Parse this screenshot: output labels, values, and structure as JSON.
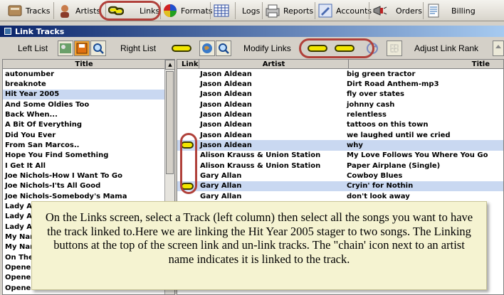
{
  "tabs": [
    {
      "label": "Tracks",
      "icon": "tracks-icon"
    },
    {
      "label": "Artists",
      "icon": "artists-icon"
    },
    {
      "label": "Links",
      "icon": "chain-link-icon"
    },
    {
      "label": "Formats",
      "icon": "color-wheel-icon"
    },
    {
      "label": "",
      "icon": "grid-icon"
    },
    {
      "label": "Logs",
      "icon": "logs-icon"
    },
    {
      "label": "Reports",
      "icon": "reports-icon"
    },
    {
      "label": "Accounts",
      "icon": "accounts-icon"
    },
    {
      "label": "Orders",
      "icon": "megaphone-icon"
    },
    {
      "label": "Billing",
      "icon": "billing-icon"
    }
  ],
  "window": {
    "title": "Link Tracks"
  },
  "toolbar": {
    "left_list": "Left List",
    "right_list": "Right List",
    "modify_links": "Modify Links",
    "adjust_rank": "Adjust Link Rank"
  },
  "left_pane": {
    "header": "Title",
    "rows": [
      "autonumber",
      "breaknote",
      "Hit Year 2005",
      "And Some Oldies Too",
      "Back When...",
      "A Bit Of Everything",
      "Did You Ever",
      "From San Marcos..",
      "Hope You Find Something",
      "I Get It All",
      "Joe Nichols-How I Want To Go",
      "Joe Nichols-I'ts All Good",
      "Joe Nichols-Somebody's Mama",
      "Lady A-",
      "Lady A-",
      "Lady A-",
      "My Nam",
      "My Nam",
      "On The",
      "Opener",
      "Opener",
      "Opener"
    ],
    "selected_index": 2
  },
  "right_pane": {
    "headers": {
      "link": "Link",
      "artist": "Artist",
      "title": "Title"
    },
    "rows": [
      {
        "artist": "Jason Aldean",
        "title": "big green tractor",
        "linked": false
      },
      {
        "artist": "Jason Aldean",
        "title": "Dirt Road Anthem-mp3",
        "linked": false
      },
      {
        "artist": "Jason Aldean",
        "title": "fly over states",
        "linked": false
      },
      {
        "artist": "Jason Aldean",
        "title": "johnny cash",
        "linked": false
      },
      {
        "artist": "Jason Aldean",
        "title": "relentless",
        "linked": false
      },
      {
        "artist": "Jason Aldean",
        "title": "tattoos on this town",
        "linked": false
      },
      {
        "artist": "Jason Aldean",
        "title": "we laughed until we cried",
        "linked": false
      },
      {
        "artist": "Jason Aldean",
        "title": "why",
        "linked": true
      },
      {
        "artist": "Alison Krauss & Union Station",
        "title": "My Love Follows You Where You Go",
        "linked": false
      },
      {
        "artist": "Alison Krauss & Union Station",
        "title": "Paper Airplane (Single)",
        "linked": false
      },
      {
        "artist": "Gary Allan",
        "title": "Cowboy Blues",
        "linked": false
      },
      {
        "artist": "Gary Allan",
        "title": "Cryin' for Nothin",
        "linked": true
      },
      {
        "artist": "Gary Allan",
        "title": "don't look away",
        "linked": false
      }
    ]
  },
  "callout": {
    "text": "On the Links screen, select a Track (left column) then select all the songs you want to have the track linked to.Here we are linking the Hit Year 2005 stager to two songs.  The Linking buttons at the top of the screen link and un-link tracks.  The \"chain' icon next to an artist name indicates it is linked to the track."
  },
  "colors": {
    "selection": "#c9d8f1",
    "highlight_oval": "#b0403a",
    "callout_bg": "#f5f3d1",
    "chain": "#f2e600",
    "titlebar": "#0a246a"
  }
}
